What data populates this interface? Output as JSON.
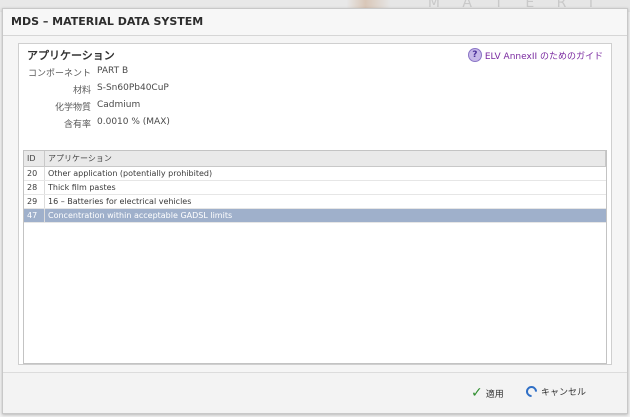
{
  "background_letters": "M A T E R I",
  "window": {
    "title": "MDS – MATERIAL DATA SYSTEM"
  },
  "panel": {
    "title": "アプリケーション",
    "guide_link": "ELV AnnexII のためのガイド",
    "fields": [
      {
        "label": "コンポーネント",
        "value": "PART B"
      },
      {
        "label": "材料",
        "value": "S-Sn60Pb40CuP"
      },
      {
        "label": "化学物質",
        "value": "Cadmium"
      },
      {
        "label": "含有率",
        "value": "0.0010 % (MAX)"
      }
    ]
  },
  "table": {
    "columns": [
      "ID",
      "アプリケーション"
    ],
    "rows": [
      {
        "id": "20",
        "application": "Other application (potentially prohibited)",
        "selected": false
      },
      {
        "id": "28",
        "application": "Thick film pastes",
        "selected": false
      },
      {
        "id": "29",
        "application": "16 – Batteries for electrical vehicles",
        "selected": false
      },
      {
        "id": "47",
        "application": "Concentration within acceptable GADSL limits",
        "selected": true
      }
    ]
  },
  "buttons": {
    "apply_label": "適用",
    "cancel_label": "キャンセル"
  },
  "icons": {
    "help": "help-icon",
    "apply": "checkmark-icon",
    "cancel": "cancel-icon"
  },
  "colors": {
    "selected_row": "#9fb0cb",
    "guide_link": "#7a2aa0",
    "apply_check": "#2f8f2f",
    "cancel_icon": "#2f6fc6"
  }
}
